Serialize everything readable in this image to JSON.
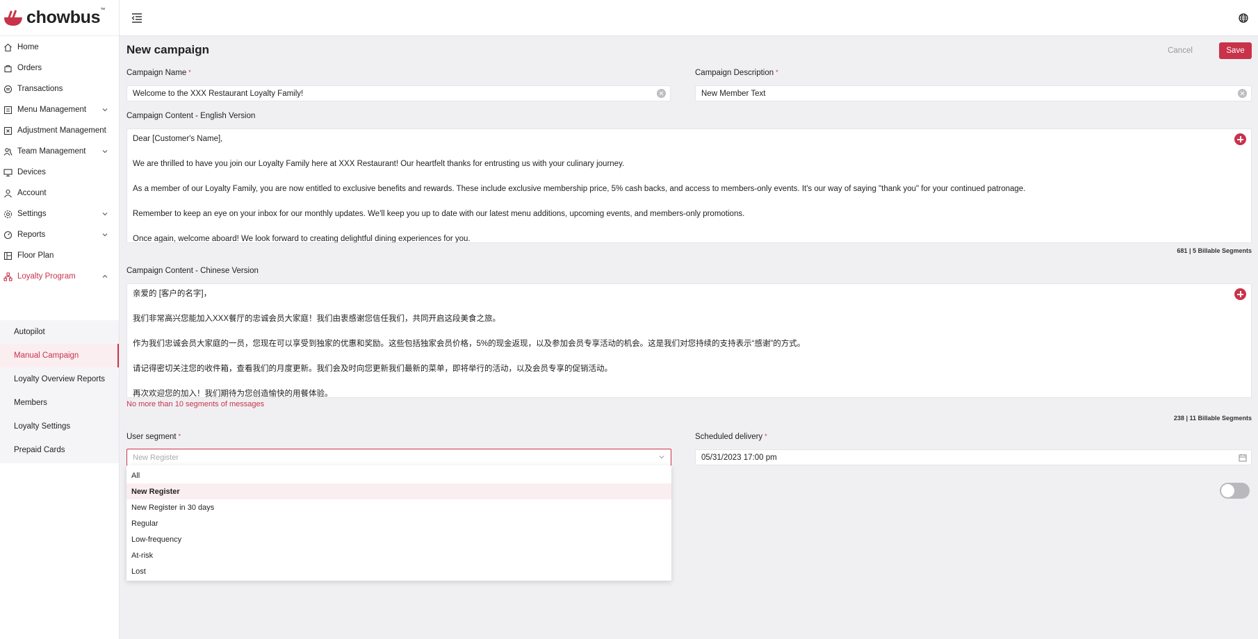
{
  "brand": {
    "name": "chowbus",
    "trademark": "™",
    "color": "#c8334a"
  },
  "sidebar": {
    "items": [
      {
        "label": "Home",
        "icon": "home-icon"
      },
      {
        "label": "Orders",
        "icon": "bag-icon"
      },
      {
        "label": "Transactions",
        "icon": "transactions-icon"
      },
      {
        "label": "Menu Management",
        "icon": "menu-icon",
        "expandable": true
      },
      {
        "label": "Adjustment Management",
        "icon": "adjustment-icon"
      },
      {
        "label": "Team Management",
        "icon": "team-icon",
        "expandable": true
      },
      {
        "label": "Devices",
        "icon": "monitor-icon"
      },
      {
        "label": "Account",
        "icon": "user-icon"
      },
      {
        "label": "Settings",
        "icon": "gear-icon",
        "expandable": true
      },
      {
        "label": "Reports",
        "icon": "gauge-icon",
        "expandable": true
      },
      {
        "label": "Floor Plan",
        "icon": "floor-plan-icon"
      },
      {
        "label": "Loyalty Program",
        "icon": "loyalty-icon",
        "expandable": true,
        "active": true
      }
    ],
    "loyalty_sub": [
      "Autopilot",
      "Manual Campaign",
      "Loyalty Overview Reports",
      "Members",
      "Loyalty Settings",
      "Prepaid Cards"
    ],
    "active_sub": "Manual Campaign"
  },
  "header": {
    "title": "New campaign",
    "cancel_label": "Cancel",
    "save_label": "Save"
  },
  "form": {
    "campaign_name": {
      "label": "Campaign Name",
      "required": "*",
      "value": "Welcome to the XXX Restaurant Loyalty Family!"
    },
    "campaign_description": {
      "label": "Campaign Description",
      "required": "*",
      "value": "New Member Text"
    },
    "content_en": {
      "label": "Campaign Content - English Version",
      "paragraphs": [
        "Dear [Customer's Name],",
        "We are thrilled to have you join our Loyalty Family here at XXX Restaurant! Our heartfelt thanks for entrusting us with your culinary journey.",
        "As a member of our Loyalty Family, you are now entitled to exclusive benefits and rewards. These include exclusive membership price, 5% cash backs, and access to members-only events. It's our way of saying \"thank you\" for your continued patronage.",
        "Remember to keep an eye on your inbox for our monthly updates. We'll keep you up to date with our latest menu additions, upcoming events, and members-only promotions.",
        "Once again, welcome aboard! We look forward to creating delightful dining experiences for you."
      ],
      "segments": "681 | 5 Billable Segments"
    },
    "content_zh": {
      "label": "Campaign Content - Chinese Version",
      "paragraphs": [
        "亲爱的 [客户的名字]，",
        "我们非常高兴您能加入XXX餐厅的忠诚会员大家庭！我们由衷感谢您信任我们，共同开启这段美食之旅。",
        "作为我们忠诚会员大家庭的一员，您现在可以享受到独家的优惠和奖励。这些包括独家会员价格，5%的现金返现，以及参加会员专享活动的机会。这是我们对您持续的支持表示“感谢”的方式。",
        "请记得密切关注您的收件箱，查看我们的月度更新。我们会及时向您更新我们最新的菜单，即将举行的活动，以及会员专享的促销活动。",
        "再次欢迎您的加入！我们期待为您创造愉快的用餐体验。"
      ],
      "error": "No more than 10 segments of messages",
      "segments": "238 | 11 Billable Segments"
    },
    "user_segment": {
      "label": "User segment",
      "required": "*",
      "placeholder": "New Register",
      "options": [
        "All",
        "New Register",
        "New Register in 30 days",
        "Regular",
        "Low-frequency",
        "At-risk",
        "Lost"
      ],
      "selected": "New Register"
    },
    "scheduled_delivery": {
      "label": "Scheduled delivery",
      "required": "*",
      "value": "05/31/2023 17:00 pm"
    },
    "toggle_on": false
  }
}
